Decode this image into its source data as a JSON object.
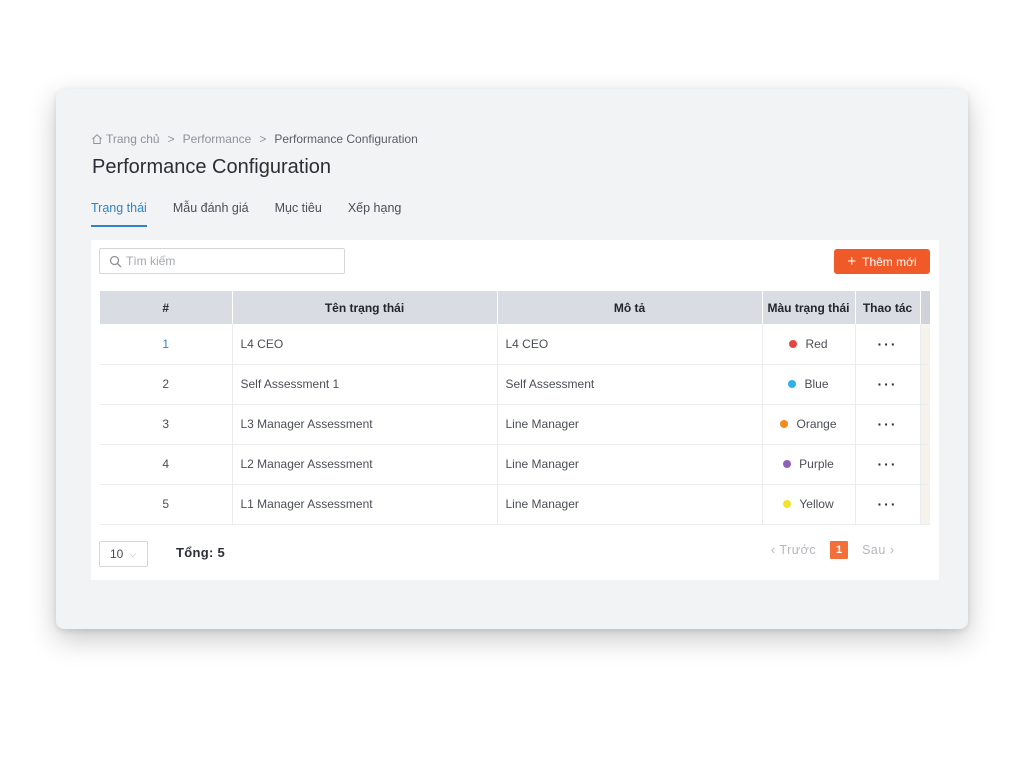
{
  "breadcrumb": {
    "home": "Trang chủ",
    "sep": ">",
    "level1": "Performance",
    "current": "Performance Configuration"
  },
  "page_title": "Performance Configuration",
  "tabs": [
    {
      "label": "Trạng thái",
      "active": true
    },
    {
      "label": "Mẫu đánh giá",
      "active": false
    },
    {
      "label": "Mục tiêu",
      "active": false
    },
    {
      "label": "Xếp hạng",
      "active": false
    }
  ],
  "search": {
    "placeholder": "Tìm kiếm",
    "value": ""
  },
  "add_button": {
    "label": "Thêm mới",
    "icon": "plus-icon"
  },
  "table": {
    "headers": {
      "num": "#",
      "name": "Tên trạng thái",
      "desc": "Mô tả",
      "color": "Màu trạng thái",
      "action": "Thao tác"
    },
    "rows": [
      {
        "num": "1",
        "name": "L4 CEO",
        "desc": "L4 CEO",
        "color_label": "Red",
        "color_hex": "#e04848",
        "action": "···"
      },
      {
        "num": "2",
        "name": "Self Assessment 1",
        "desc": "Self Assessment",
        "color_label": "Blue",
        "color_hex": "#2fb0ec",
        "action": "···"
      },
      {
        "num": "3",
        "name": "L3 Manager Assessment",
        "desc": "Line Manager",
        "color_label": "Orange",
        "color_hex": "#f28a1c",
        "action": "···"
      },
      {
        "num": "4",
        "name": "L2 Manager Assessment",
        "desc": "Line Manager",
        "color_label": "Purple",
        "color_hex": "#8f61b5",
        "action": "···"
      },
      {
        "num": "5",
        "name": "L1 Manager Assessment",
        "desc": "Line Manager",
        "color_label": "Yellow",
        "color_hex": "#f3e22c",
        "action": "···"
      }
    ]
  },
  "footer": {
    "page_size": "10",
    "total": "Tổng: 5",
    "prev": "Trước",
    "current_page": "1",
    "next": "Sau"
  },
  "colors": {
    "accent": "#2f84c9",
    "primary_button": "#f05a28",
    "active_page": "#f36f3a"
  }
}
